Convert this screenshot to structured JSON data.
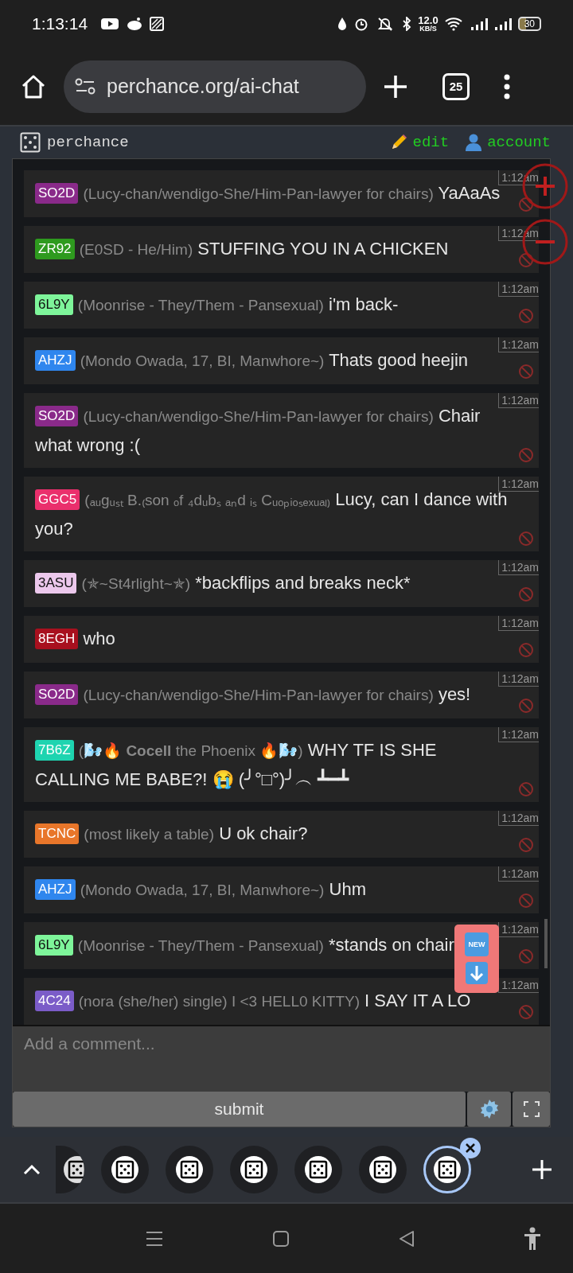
{
  "status_bar": {
    "time": "1:13:14",
    "net_speed": "12.0",
    "net_unit": "KB/S",
    "battery": "30"
  },
  "browser": {
    "url": "perchance.org/ai-chat",
    "tab_count": "25"
  },
  "site_header": {
    "logo": "perchance",
    "edit": "edit",
    "account": "account"
  },
  "messages": [
    {
      "badge": "SO2D",
      "color": "#8a2a8a",
      "name": "(Lucy-chan/wendigo-She/Him-Pan-lawyer for chairs)",
      "text": "YaAaAs",
      "time": "1:12am"
    },
    {
      "badge": "ZR92",
      "color": "#2e9a1e",
      "name": "(E0SD - He/Him)",
      "text": "STUFFING YOU IN A CHICKEN",
      "time": "1:12am"
    },
    {
      "badge": "6L9Y",
      "color": "#7ef59a",
      "name": "(Moonrise - They/Them - Pansexual)",
      "text": "i'm back-",
      "time": "1:12am"
    },
    {
      "badge": "AHZJ",
      "color": "#2f86ee",
      "name": "(Mondo Owada, 17, BI, Manwhore~)",
      "text": "Thats good heejin",
      "time": "1:12am"
    },
    {
      "badge": "SO2D",
      "color": "#8a2a8a",
      "name": "(Lucy-chan/wendigo-She/Him-Pan-lawyer for chairs)",
      "text": "Chair what wrong :(",
      "time": "1:12am"
    },
    {
      "badge": "GGC5",
      "color": "#ea2f6c",
      "name": "(ₐᵤgᵤₛₜ B.₍son ₒf ₄dᵤbₛ ₐₙd ᵢₛ Cᵤₒₚᵢₒₛₑₓᵤₐₗ₎",
      "text": "Lucy, can I dance with you?",
      "time": "1:12am"
    },
    {
      "badge": "3ASU",
      "color": "#ecc8ec",
      "name": "(✯~St4rlight~✯)",
      "text": "*backflips and breaks neck*",
      "time": "1:12am"
    },
    {
      "badge": "8EGH",
      "color": "#a8101e",
      "text": "who",
      "time": "1:12am"
    },
    {
      "badge": "SO2D",
      "color": "#8a2a8a",
      "name": "(Lucy-chan/wendigo-She/Him-Pan-lawyer for chairs)",
      "text": "yes!",
      "time": "1:12am"
    },
    {
      "badge": "7B6Z",
      "color": "#1ed4b0",
      "name": "(🌬️🔥 **Cocell** the Phoenix 🔥🌬️)",
      "text": "WHY TF IS SHE CALLING ME BABE?! 😭 (╯°□°)╯︵ ┻━┻",
      "time": "1:12am"
    },
    {
      "badge": "TCNC",
      "color": "#e8762a",
      "name": "(most likely a table)",
      "text": "U ok chair?",
      "time": "1:12am"
    },
    {
      "badge": "AHZJ",
      "color": "#2f86ee",
      "name": "(Mondo Owada, 17, BI, Manwhore~)",
      "text": "Uhm",
      "time": "1:12am"
    },
    {
      "badge": "6L9Y",
      "color": "#7ef59a",
      "name": "(Moonrise - They/Them - Pansexual)",
      "text": "*stands on chair",
      "time": "1:12am"
    },
    {
      "badge": "4C24",
      "color": "#7b5cc8",
      "name": "(nora (she/her) single) I <3 HELL0 KITTY)",
      "text": "I SAY IT A LO",
      "time": "1:12am"
    }
  ],
  "new_button": {
    "label": "NEW"
  },
  "composer": {
    "placeholder": "Add a comment...",
    "submit": "submit"
  },
  "tabs": [
    {
      "selected": false
    },
    {
      "selected": false
    },
    {
      "selected": false
    },
    {
      "selected": false
    },
    {
      "selected": false
    },
    {
      "selected": false
    },
    {
      "selected": true
    }
  ]
}
